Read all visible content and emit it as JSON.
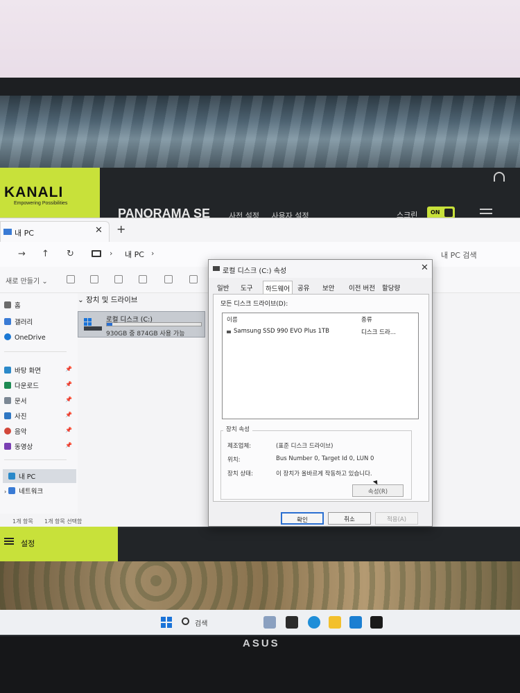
{
  "kanali": {
    "logo": "KANALI",
    "tagline": "Empowering Possibilities",
    "title": "PANORAMA SE",
    "menu": [
      "사전 설정",
      "사용자 설정"
    ],
    "screen_label": "스크린",
    "toggle": "ON",
    "settings_label": "설정"
  },
  "explorer": {
    "tab_title": "내 PC",
    "address": "내 PC",
    "search_placeholder": "내 PC 검색",
    "new_button": "새로 만들기",
    "nav": {
      "home": "홈",
      "gallery": "갤러리",
      "onedrive": "OneDrive",
      "desktop": "바탕 화면",
      "downloads": "다운로드",
      "documents": "문서",
      "pictures": "사진",
      "music": "음악",
      "videos": "동영상",
      "this_pc": "내 PC",
      "network": "네트워크"
    },
    "group_heading": "장치 및 드라이브",
    "drive": {
      "name": "로컬 디스크 (C:)",
      "size_text": "930GB 중 874GB 사용 가능",
      "used_fraction": 0.06
    },
    "status": {
      "count": "1개 항목",
      "selected": "1개 항목 선택함"
    }
  },
  "dialog": {
    "title": "로컬 디스크 (C:) 속성",
    "tabs": [
      "일반",
      "도구",
      "하드웨어",
      "공유",
      "보안",
      "이전 버전",
      "할당량"
    ],
    "active_tab": "하드웨어",
    "all_drives_label": "모든 디스크 드라이브(D):",
    "columns": [
      "이름",
      "종류"
    ],
    "rows": [
      {
        "name": "Samsung SSD 990 EVO Plus 1TB",
        "type": "디스크 드라..."
      }
    ],
    "device_props_legend": "장치 속성",
    "props": {
      "manufacturer_label": "제조업체:",
      "manufacturer_value": "(표준 디스크 드라이브)",
      "location_label": "위치:",
      "location_value": "Bus Number 0, Target Id 0, LUN 0",
      "status_label": "장치 상태:",
      "status_value": "이 장치가 올바르게 작동하고 있습니다."
    },
    "properties_button": "속성(R)",
    "ok_button": "확인",
    "cancel_button": "취소",
    "apply_button": "적용(A)"
  },
  "taskbar": {
    "search_label": "검색"
  },
  "monitor": {
    "brand": "ASUS"
  },
  "colors": {
    "kanali_accent": "#c8e13a",
    "selection_blue": "#2a6fd1"
  }
}
